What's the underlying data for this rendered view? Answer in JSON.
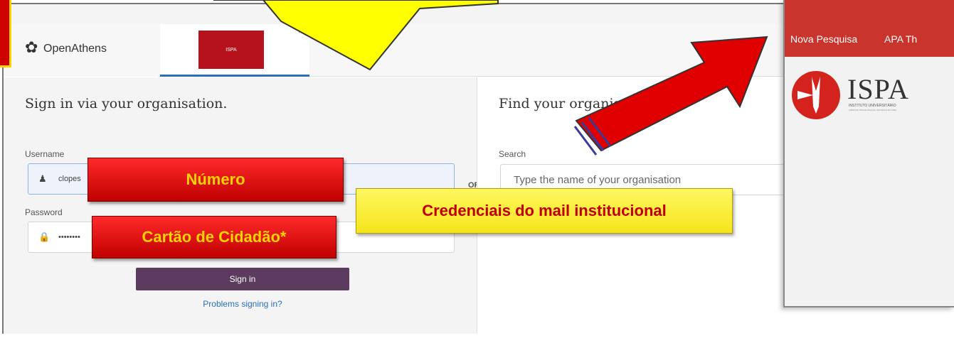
{
  "openathens": {
    "brand": "OpenAthens",
    "org_tab_logo": "ISPA",
    "tab_close": "×",
    "signin_heading": "Sign in via your organisation.",
    "username_label": "Username",
    "username_value": "clopes",
    "password_label": "Password",
    "password_value": "••••••••",
    "signin_button": "Sign in",
    "problems_link": "Problems signing in?",
    "or_label": "OR",
    "find_heading": "Find your organisation.",
    "search_label": "Search",
    "search_placeholder": "Type the name of your organisation"
  },
  "ispa_window": {
    "nav_items": [
      "Nova Pesquisa",
      "APA Th"
    ],
    "brand": "ISPA",
    "sub_line_1": "INSTITUTO UNIVERSITÁRIO",
    "sub_line_2": "CIÊNCIAS PSICOLÓGICAS, SOCIAIS E DA VIDA",
    "nav_color": "#c9352d"
  },
  "annotations": {
    "numero": "Número",
    "cartao": "Cartão de Cidadão*",
    "credenciais": "Credenciais do mail institucional",
    "callout_color": "#ffff00",
    "badge_color": "#e00000"
  }
}
